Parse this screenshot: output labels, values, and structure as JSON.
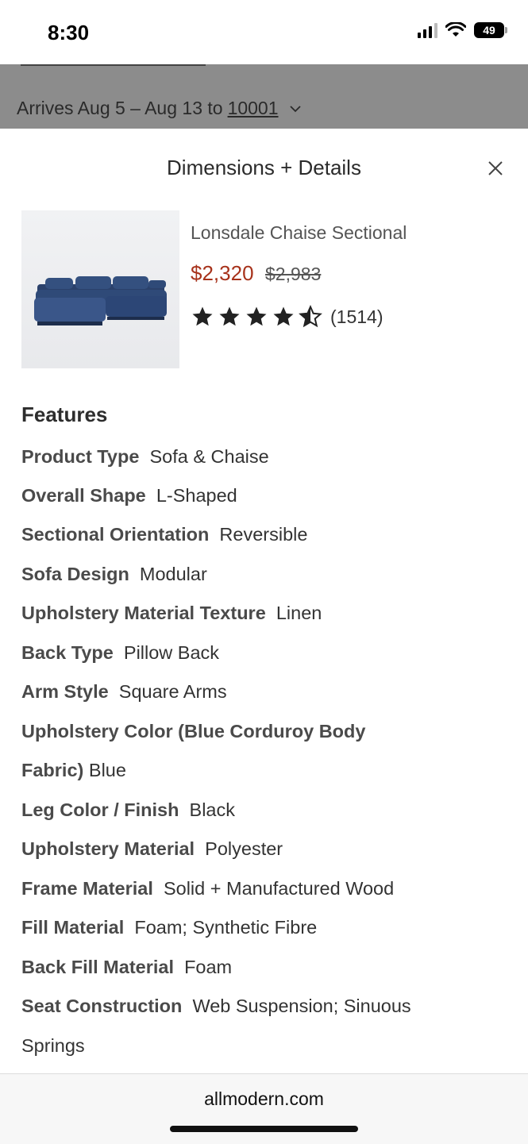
{
  "status_bar": {
    "time": "8:30",
    "battery": "49"
  },
  "underlay": {
    "arrives_prefix": "Arrives Aug 5 – Aug 13 to",
    "zip": "10001"
  },
  "sheet": {
    "title": "Dimensions + Details",
    "product": {
      "name": "Lonsdale Chaise Sectional",
      "price": "$2,320",
      "old_price": "$2,983",
      "rating_stars": 4.5,
      "review_count": "(1514)"
    },
    "features_heading": "Features",
    "features": [
      {
        "label": "Product Type",
        "value": "Sofa & Chaise"
      },
      {
        "label": "Overall Shape",
        "value": "L-Shaped"
      },
      {
        "label": "Sectional Orientation",
        "value": "Reversible"
      },
      {
        "label": "Sofa Design",
        "value": "Modular"
      },
      {
        "label": "Upholstery Material Texture",
        "value": "Linen"
      },
      {
        "label": "Back Type",
        "value": "Pillow Back"
      },
      {
        "label": "Arm Style",
        "value": "Square Arms"
      },
      {
        "label": "Upholstery Color (Blue Corduroy Body",
        "value": ""
      },
      {
        "label": "Fabric)",
        "value": "Blue"
      },
      {
        "label": "Leg Color / Finish",
        "value": "Black"
      },
      {
        "label": "Upholstery Material",
        "value": "Polyester"
      },
      {
        "label": "Frame Material",
        "value": "Solid + Manufactured Wood"
      },
      {
        "label": "Fill Material",
        "value": "Foam; Synthetic Fibre"
      },
      {
        "label": "Back Fill Material",
        "value": "Foam"
      },
      {
        "label": "Seat Construction",
        "value": "Web Suspension; Sinuous"
      },
      {
        "label": "",
        "value": "Springs"
      }
    ]
  },
  "browser": {
    "domain": "allmodern.com"
  },
  "colors": {
    "price": "#a7321b",
    "sofa": "#2f4a78"
  }
}
